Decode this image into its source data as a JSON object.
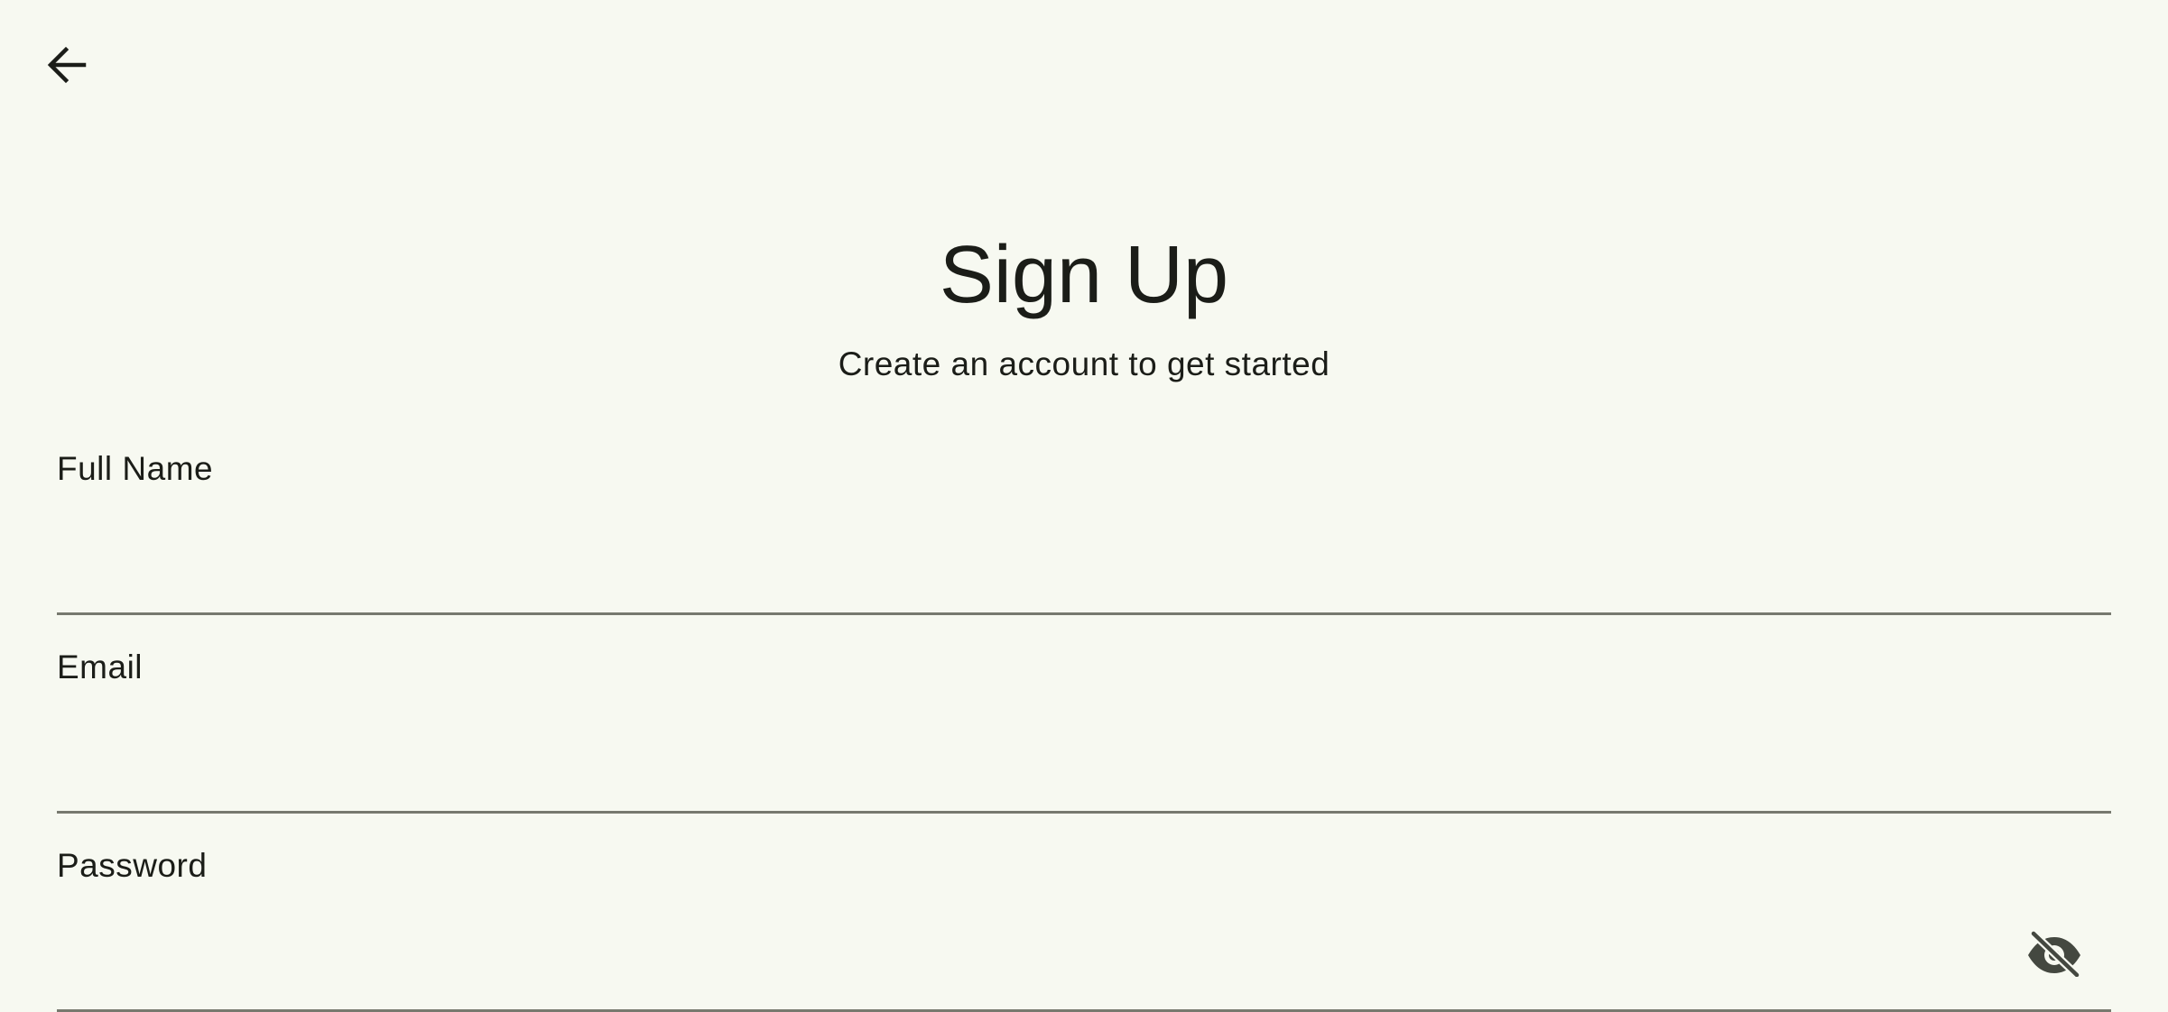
{
  "header": {
    "back_icon": "arrow-left-icon"
  },
  "page": {
    "title": "Sign Up",
    "subtitle": "Create an account to get started"
  },
  "form": {
    "full_name": {
      "label": "Full Name",
      "value": ""
    },
    "email": {
      "label": "Email",
      "value": ""
    },
    "password": {
      "label": "Password",
      "value": "",
      "toggle_icon": "visibility-off-icon"
    }
  },
  "colors": {
    "background": "#f7f9f1",
    "text": "#1b1d18",
    "underline": "#77796f",
    "icon": "#444840"
  }
}
